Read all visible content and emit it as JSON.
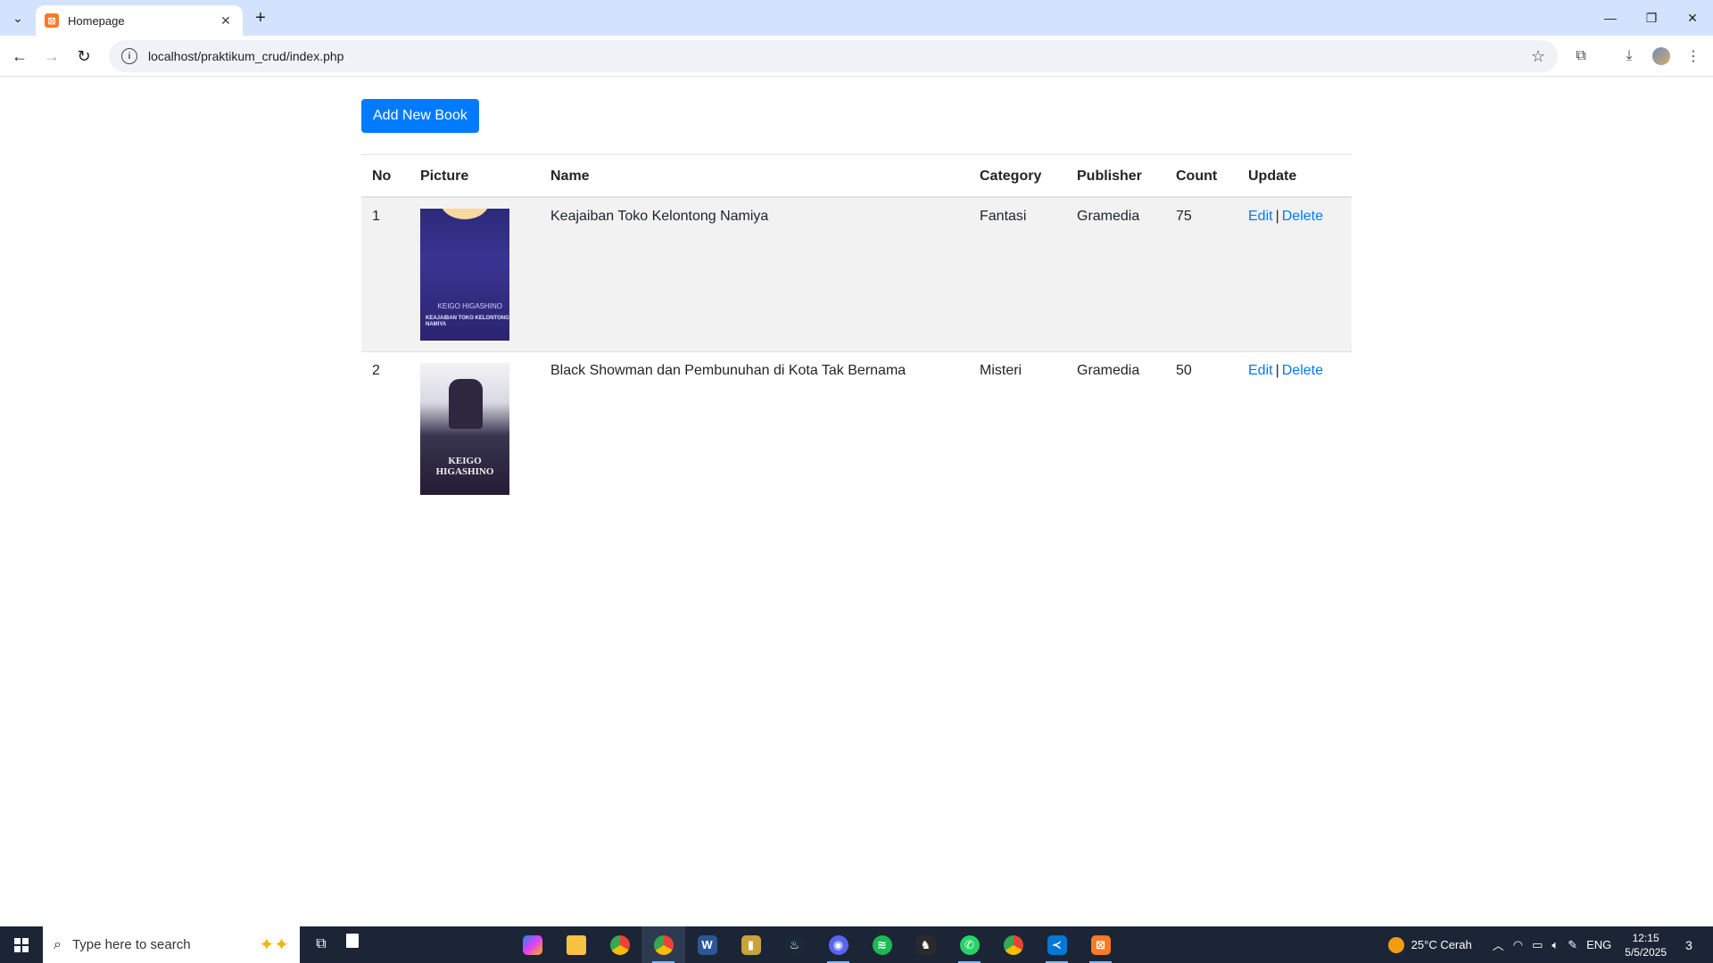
{
  "browser": {
    "tab_title": "Homepage",
    "url": "localhost/praktikum_crud/index.php"
  },
  "page": {
    "add_button_label": "Add New Book",
    "table": {
      "headers": [
        "No",
        "Picture",
        "Name",
        "Category",
        "Publisher",
        "Count",
        "Update"
      ],
      "rows": [
        {
          "no": "1",
          "cover_title": "KEAJAIBAN TOKO KELONTONG NAMIYA",
          "cover_author": "KEIGO HIGASHINO",
          "name": "Keajaiban Toko Kelontong Namiya",
          "category": "Fantasi",
          "publisher": "Gramedia",
          "count": "75",
          "edit_label": "Edit",
          "separator": "|",
          "delete_label": "Delete"
        },
        {
          "no": "2",
          "cover_author": "KEIGO HIGASHINO",
          "name": "Black Showman dan Pembunuhan di Kota Tak Bernama",
          "category": "Misteri",
          "publisher": "Gramedia",
          "count": "50",
          "edit_label": "Edit",
          "separator": "|",
          "delete_label": "Delete"
        }
      ]
    }
  },
  "taskbar": {
    "search_placeholder": "Type here to search",
    "weather": "25°C  Cerah",
    "language": "ENG",
    "time": "12:15",
    "date": "5/5/2025",
    "notification_count": "3"
  },
  "colors": {
    "primary": "#007bff",
    "striped_row": "#f2f2f2",
    "taskbar": "#1c2536",
    "tabbar": "#d3e3fd"
  },
  "icons": {
    "tab_favicon": "xampp-icon",
    "taskbar_apps": [
      "copilot-icon",
      "file-explorer-icon",
      "chrome-icon",
      "chrome-profile-icon",
      "word-icon",
      "notes-icon",
      "steam-icon",
      "discord-icon",
      "spotify-icon",
      "game-icon",
      "whatsapp-icon",
      "chrome-alt-icon",
      "vscode-icon",
      "xampp-icon"
    ]
  }
}
